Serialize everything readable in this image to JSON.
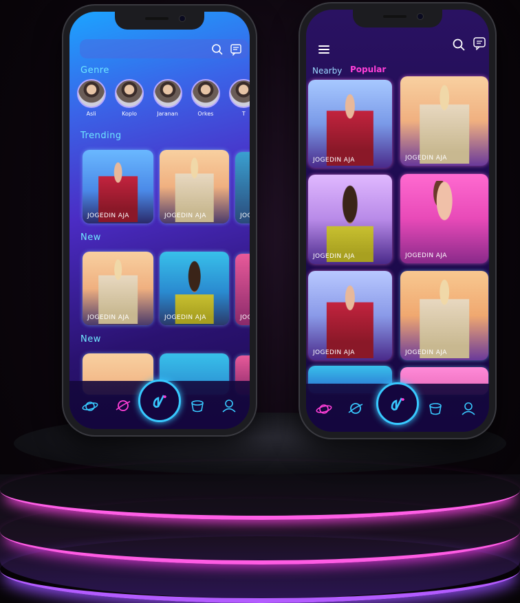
{
  "left_phone": {
    "sections": {
      "genre": "Genre",
      "trending": "Trending",
      "new1": "New",
      "new2": "New"
    },
    "genres": [
      {
        "label": "Asli"
      },
      {
        "label": "Koplo"
      },
      {
        "label": "Jaranan"
      },
      {
        "label": "Orkes"
      },
      {
        "label": "T"
      }
    ],
    "card_label": "JOGEDIN AJA",
    "trending_cards": [
      "JOGEDIN AJA",
      "JOGEDIN AJA",
      "JOG"
    ],
    "new_cards": [
      "JOGEDIN AJA",
      "JOGEDIN AJA",
      "JOG"
    ]
  },
  "right_phone": {
    "tabs": {
      "nearby": "Nearby",
      "popular": "Popular"
    },
    "grid_cards": [
      "JOGEDIN AJA",
      "JOGEDIN AJA",
      "JOGEDIN AJA",
      "JOGEDIN AJA",
      "JOGEDIN AJA",
      "JOGEDIN AJA"
    ]
  },
  "colors": {
    "accent_pink": "#ff3fd8",
    "accent_cyan": "#38c9ff",
    "section_cyan": "#5fe6ff"
  },
  "icons": [
    "search-icon",
    "chat-icon",
    "menu-icon",
    "planet-icon",
    "search-nav-icon",
    "dance-logo-icon",
    "cup-icon",
    "profile-icon"
  ]
}
